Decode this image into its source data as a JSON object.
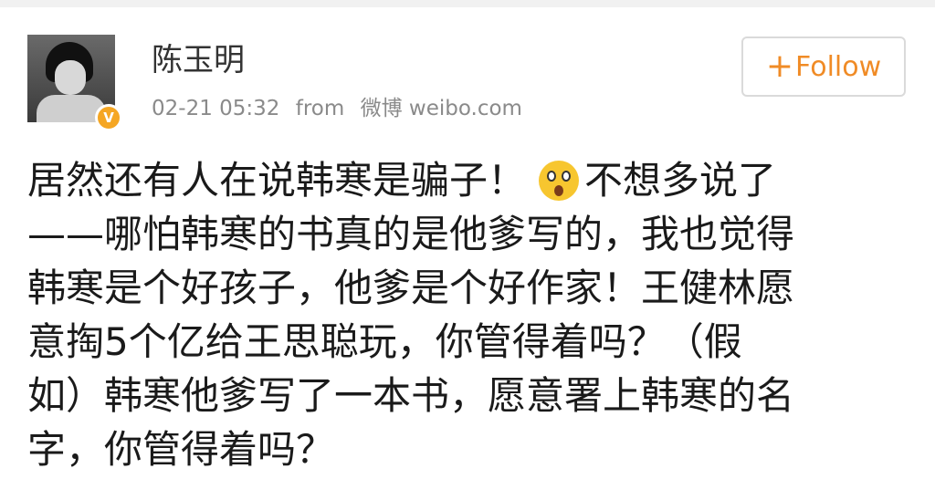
{
  "post": {
    "author": {
      "name": "陈玉明",
      "verified_badge": "V"
    },
    "meta": {
      "time": "02-21 05:32",
      "from_label": "from",
      "source": "微博 weibo.com"
    },
    "follow_label": "Follow",
    "follow_plus": "+",
    "text_lines": [
      "居然还有人在说韩寒是骗子！",
      "不想多说了",
      "——哪怕韩寒的书真的是他爹写的，我也觉得",
      "韩寒是个好孩子，他爹是个好作家！王健林愿",
      "意掏5个亿给王思聪玩，你管得着吗？（假",
      "如）韩寒他爹写了一本书，愿意署上韩寒的名",
      "字，你管得着吗？"
    ],
    "emoji": "surprised-face-emoji"
  },
  "colors": {
    "accent": "#f08b26",
    "badge": "#f5a623",
    "meta_text": "#8a8a8a"
  }
}
